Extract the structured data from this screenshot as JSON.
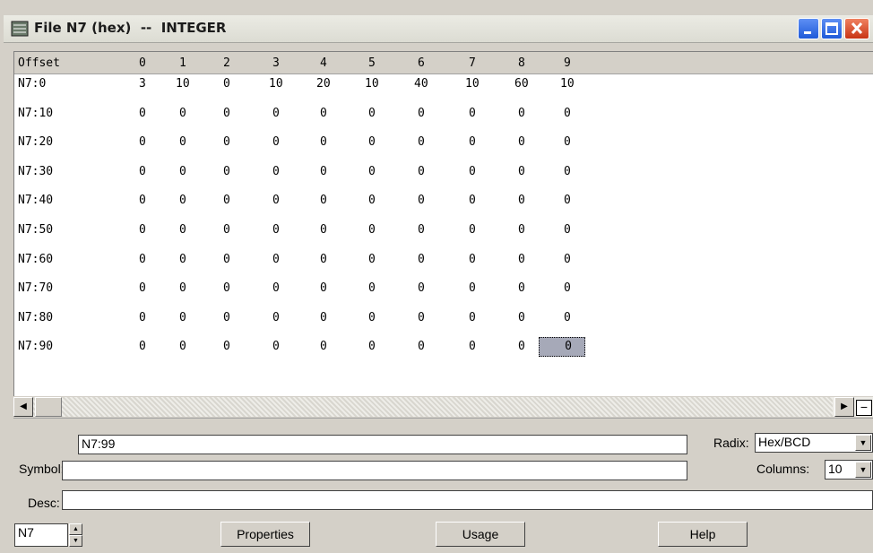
{
  "window": {
    "title": "File N7 (hex)  --  INTEGER"
  },
  "grid": {
    "offset_header": "Offset",
    "columns": [
      "0",
      "1",
      "2",
      "3",
      "4",
      "5",
      "6",
      "7",
      "8",
      "9"
    ],
    "rows": [
      {
        "label": "N7:0",
        "values": [
          "3",
          "10",
          "0",
          "10",
          "20",
          "10",
          "40",
          "10",
          "60",
          "10"
        ]
      },
      {
        "label": "N7:10",
        "values": [
          "0",
          "0",
          "0",
          "0",
          "0",
          "0",
          "0",
          "0",
          "0",
          "0"
        ]
      },
      {
        "label": "N7:20",
        "values": [
          "0",
          "0",
          "0",
          "0",
          "0",
          "0",
          "0",
          "0",
          "0",
          "0"
        ]
      },
      {
        "label": "N7:30",
        "values": [
          "0",
          "0",
          "0",
          "0",
          "0",
          "0",
          "0",
          "0",
          "0",
          "0"
        ]
      },
      {
        "label": "N7:40",
        "values": [
          "0",
          "0",
          "0",
          "0",
          "0",
          "0",
          "0",
          "0",
          "0",
          "0"
        ]
      },
      {
        "label": "N7:50",
        "values": [
          "0",
          "0",
          "0",
          "0",
          "0",
          "0",
          "0",
          "0",
          "0",
          "0"
        ]
      },
      {
        "label": "N7:60",
        "values": [
          "0",
          "0",
          "0",
          "0",
          "0",
          "0",
          "0",
          "0",
          "0",
          "0"
        ]
      },
      {
        "label": "N7:70",
        "values": [
          "0",
          "0",
          "0",
          "0",
          "0",
          "0",
          "0",
          "0",
          "0",
          "0"
        ]
      },
      {
        "label": "N7:80",
        "values": [
          "0",
          "0",
          "0",
          "0",
          "0",
          "0",
          "0",
          "0",
          "0",
          "0"
        ]
      },
      {
        "label": "N7:90",
        "values": [
          "0",
          "0",
          "0",
          "0",
          "0",
          "0",
          "0",
          "0",
          "0",
          "0"
        ]
      }
    ]
  },
  "address_field": {
    "value": "N7:99"
  },
  "radix": {
    "label": "Radix:",
    "value": "Hex/BCD"
  },
  "symbol": {
    "label": "Symbol:",
    "value": ""
  },
  "columns_setting": {
    "label": "Columns:",
    "value": "10"
  },
  "desc": {
    "label": "Desc:",
    "value": ""
  },
  "file_spinner": {
    "value": "N7"
  },
  "buttons": {
    "properties": "Properties",
    "usage": "Usage",
    "help": "Help"
  },
  "colors": {
    "title_close": "#c83414",
    "title_buttons": "#1f5ad8",
    "selection": "#a6a9b8"
  }
}
